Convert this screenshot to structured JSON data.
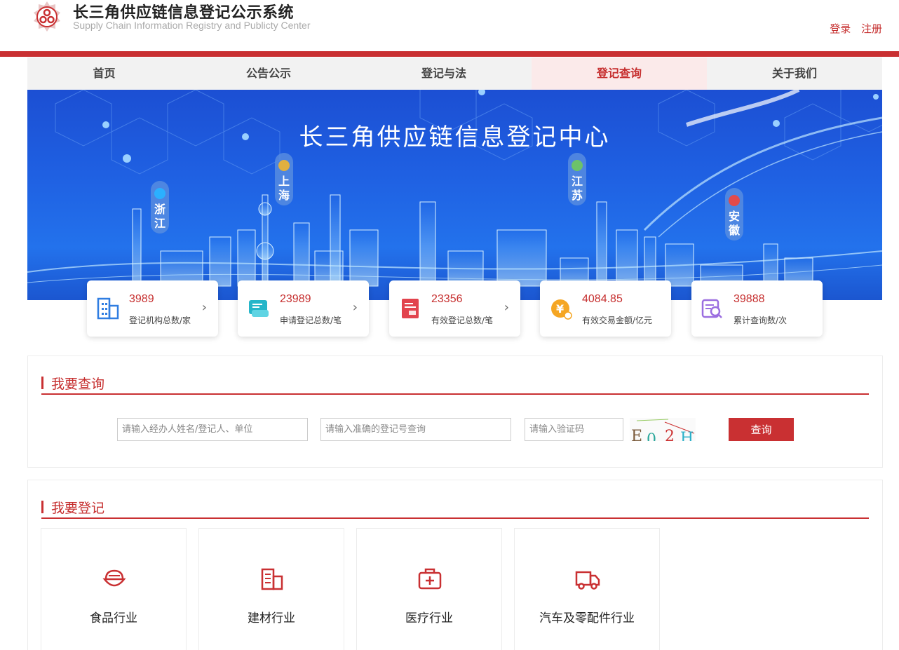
{
  "header": {
    "title": "长三角供应链信息登记公示系统",
    "subtitle": "Supply Chain Information Registry and Publicty Center",
    "login": "登录",
    "register": "注册"
  },
  "nav": [
    {
      "label": "首页",
      "active": false
    },
    {
      "label": "公告公示",
      "active": false
    },
    {
      "label": "登记与法",
      "active": false
    },
    {
      "label": "登记查询",
      "active": true
    },
    {
      "label": "关于我们",
      "active": false
    }
  ],
  "banner": {
    "title": "长三角供应链信息登记中心",
    "provinces": [
      "浙江",
      "上海",
      "江苏",
      "安徽"
    ]
  },
  "stats": [
    {
      "value": "3989",
      "label": "登记机构总数/家",
      "icon": "building-icon",
      "color": "#2f7de1"
    },
    {
      "value": "23989",
      "label": "申请登记总数/笔",
      "icon": "scroll-icon",
      "color": "#26b6c9"
    },
    {
      "value": "23356",
      "label": "有效登记总数/笔",
      "icon": "document-icon",
      "color": "#e2434d"
    },
    {
      "value": "4084.85",
      "label": "有效交易金额/亿元",
      "icon": "yuan-coin-icon",
      "color": "#f5a623"
    },
    {
      "value": "39888",
      "label": "累计查询数/次",
      "icon": "search-document-icon",
      "color": "#9b6ee0"
    }
  ],
  "query": {
    "title": "我要查询",
    "name_placeholder": "请输入经办人姓名/登记人、单位",
    "number_placeholder": "请输入准确的登记号查询",
    "captcha_placeholder": "请输入验证码",
    "captcha_text": "E02H",
    "button": "查询"
  },
  "register": {
    "title": "我要登记",
    "industries": [
      {
        "label": "食品行业",
        "icon": "food-bowl-icon"
      },
      {
        "label": "建材行业",
        "icon": "building-materials-icon"
      },
      {
        "label": "医疗行业",
        "icon": "medical-kit-icon"
      },
      {
        "label": "汽车及零配件行业",
        "icon": "truck-icon"
      }
    ]
  },
  "colors": {
    "accent": "#c93032",
    "nav_bg": "#f2f2f2",
    "nav_active_bg": "#fbeaea"
  }
}
